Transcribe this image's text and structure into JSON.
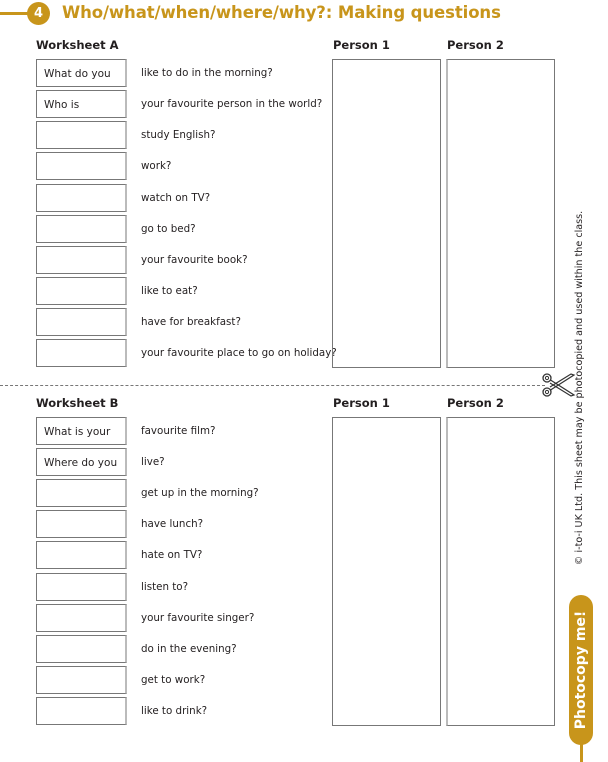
{
  "header": {
    "number": "4",
    "title": "Who/what/when/where/why?: Making questions",
    "accent_color": "#c8951b"
  },
  "worksheets": [
    {
      "label": "Worksheet A",
      "person_labels": [
        "Person 1",
        "Person 2"
      ],
      "rows": [
        {
          "prompt": "What do you",
          "question": "like to do in the morning?"
        },
        {
          "prompt": "Who is",
          "question": "your favourite person in the world?"
        },
        {
          "prompt": "",
          "question": "study English?"
        },
        {
          "prompt": "",
          "question": "work?"
        },
        {
          "prompt": "",
          "question": "watch on TV?"
        },
        {
          "prompt": "",
          "question": "go to bed?"
        },
        {
          "prompt": "",
          "question": "your favourite book?"
        },
        {
          "prompt": "",
          "question": "like to eat?"
        },
        {
          "prompt": "",
          "question": "have for breakfast?"
        },
        {
          "prompt": "",
          "question": "your favourite place to go on holiday?"
        }
      ]
    },
    {
      "label": "Worksheet B",
      "person_labels": [
        "Person 1",
        "Person 2"
      ],
      "rows": [
        {
          "prompt": "What is your",
          "question": "favourite film?"
        },
        {
          "prompt": "Where do you",
          "question": "live?"
        },
        {
          "prompt": "",
          "question": "get up in the morning?"
        },
        {
          "prompt": "",
          "question": "have lunch?"
        },
        {
          "prompt": "",
          "question": "hate on TV?"
        },
        {
          "prompt": "",
          "question": "listen to?"
        },
        {
          "prompt": "",
          "question": "your favourite singer?"
        },
        {
          "prompt": "",
          "question": "do in the evening?"
        },
        {
          "prompt": "",
          "question": "get to work?"
        },
        {
          "prompt": "",
          "question": "like to drink?"
        }
      ]
    }
  ],
  "side": {
    "copyright": "© i-to-i UK Ltd. This sheet may be photocopied and used within the class.",
    "badge": "Photocopy me!",
    "cut_icon": "scissors-icon"
  }
}
